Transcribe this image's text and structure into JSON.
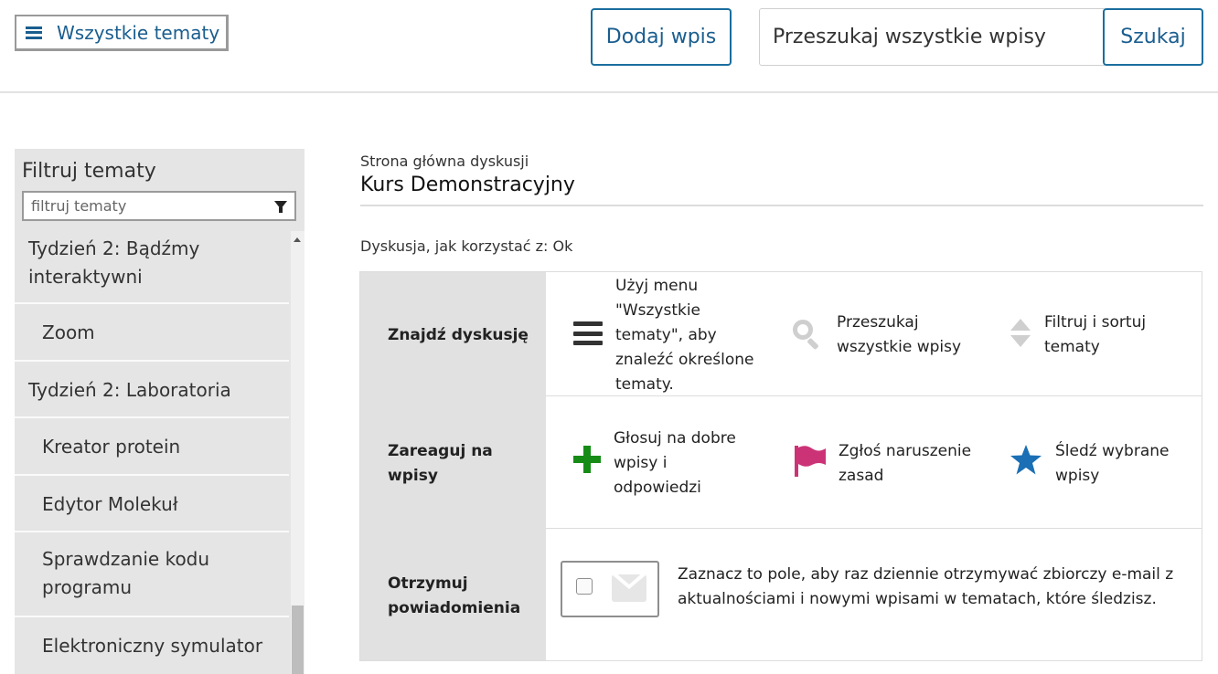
{
  "header": {
    "all_topics_label": "Wszystkie tematy",
    "add_post_label": "Dodaj wpis",
    "search_placeholder": "Przeszukaj wszystkie wpisy",
    "search_button_label": "Szukaj"
  },
  "sidebar": {
    "title": "Filtruj tematy",
    "filter_placeholder": "filtruj tematy",
    "items": [
      {
        "label": "Tydzień 2: Bądźmy interaktywni",
        "level": 1
      },
      {
        "label": "Zoom",
        "level": 2
      },
      {
        "label": "Tydzień 2: Laboratoria",
        "level": 1
      },
      {
        "label": "Kreator protein",
        "level": 2
      },
      {
        "label": "Edytor Molekuł",
        "level": 2
      },
      {
        "label": "Sprawdzanie kodu programu",
        "level": 2
      },
      {
        "label": "Elektroniczny symulator",
        "level": 2
      }
    ]
  },
  "main": {
    "breadcrumb": "Strona główna dyskusji",
    "course_title": "Kurs Demonstracyjny",
    "howto_label": "Dyskusja, jak korzystać z: Ok",
    "howto": {
      "find": {
        "label": "Znajdź dyskusję",
        "menu_tip": "Użyj menu \"Wszystkie tematy\", aby znaleźć określone tematy.",
        "search_tip": "Przeszukaj wszystkie wpisy",
        "sort_tip": "Filtruj i sortuj tematy"
      },
      "react": {
        "label": "Zareaguj na wpisy",
        "vote_tip": "Głosuj na dobre wpisy i odpowiedzi",
        "report_tip": "Zgłoś naruszenie zasad",
        "follow_tip": "Śledź wybrane wpisy"
      },
      "notify": {
        "label": "Otrzymuj powiadomienia",
        "digest_text": "Zaznacz to pole, aby raz dziennie otrzymywać zbiorczy e-mail z aktualnościami i nowymi wpisami w tematach, które śledzisz.",
        "digest_checked": false
      }
    }
  },
  "icons": {
    "menu": "menu-icon",
    "search": "search-icon",
    "sort": "sort-icon",
    "vote": "plus-icon",
    "report": "flag-icon",
    "follow": "star-icon",
    "email": "envelope-icon",
    "filter": "filter-icon"
  },
  "colors": {
    "accent": "#1a5e8f",
    "vote": "#168c16",
    "report": "#cc3377",
    "follow": "#1a6fb5",
    "sidebar_bg": "#e5e5e5"
  }
}
